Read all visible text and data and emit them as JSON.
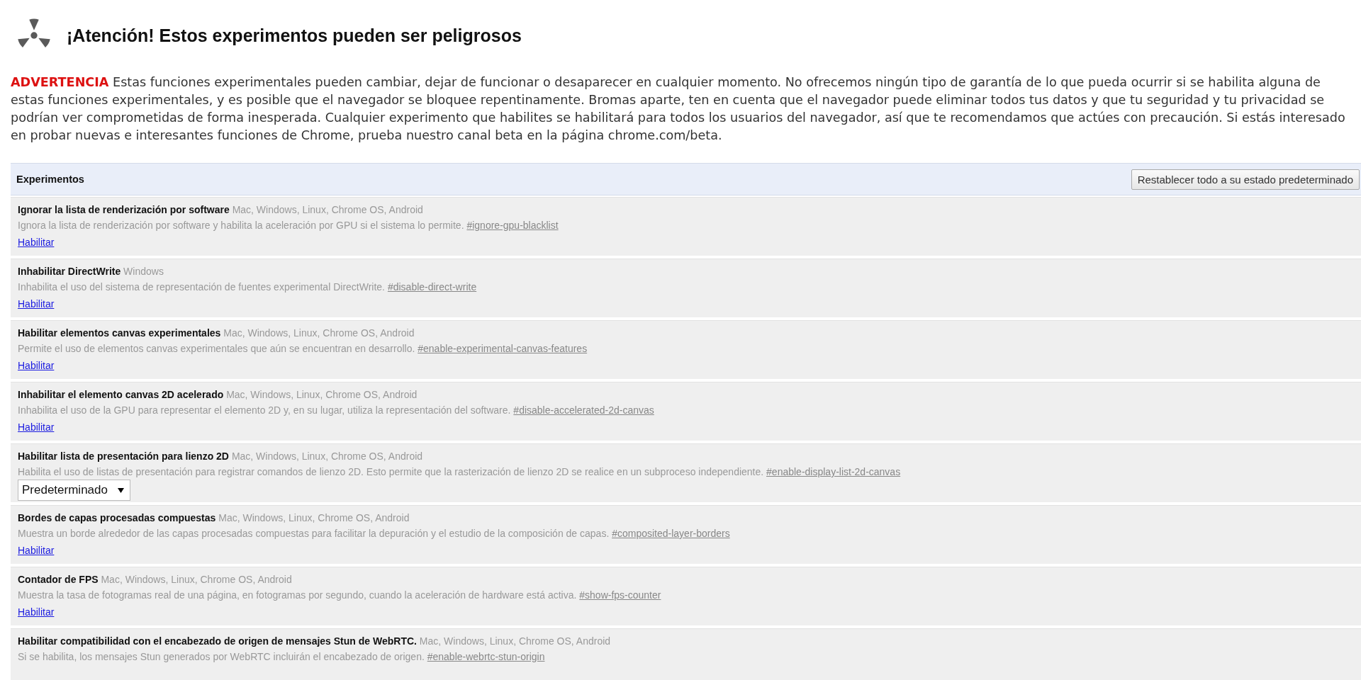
{
  "header": {
    "title": "¡Atención! Estos experimentos pueden ser peligrosos"
  },
  "warning": {
    "label": "ADVERTENCIA",
    "text": "Estas funciones experimentales pueden cambiar, dejar de funcionar o desaparecer en cualquier momento. No ofrecemos ningún tipo de garantía de lo que pueda ocurrir si se habilita alguna de estas funciones experimentales, y es posible que el navegador se bloquee repentinamente. Bromas aparte, ten en cuenta que el navegador puede eliminar todos tus datos y que tu seguridad y tu privacidad se podrían ver comprometidas de forma inesperada. Cualquier experimento que habilites se habilitará para todos los usuarios del navegador, así que te recomendamos que actúes con precaución. Si estás interesado en probar nuevas e interesantes funciones de Chrome, prueba nuestro canal beta en la página chrome.com/beta."
  },
  "experiments": {
    "heading": "Experimentos",
    "reset_button": "Restablecer todo a su estado predeterminado",
    "items": [
      {
        "name": "Ignorar la lista de renderización por software",
        "platforms": "Mac, Windows, Linux, Chrome OS, Android",
        "description": "Ignora la lista de renderización por software y habilita la aceleración por GPU si el sistema lo permite.",
        "flag": "#ignore-gpu-blacklist",
        "kind": "link",
        "control": "Habilitar"
      },
      {
        "name": "Inhabilitar DirectWrite",
        "platforms": "Windows",
        "description": "Inhabilita el uso del sistema de representación de fuentes experimental DirectWrite.",
        "flag": "#disable-direct-write",
        "kind": "link",
        "control": "Habilitar"
      },
      {
        "name": "Habilitar elementos canvas experimentales",
        "platforms": "Mac, Windows, Linux, Chrome OS, Android",
        "description": "Permite el uso de elementos canvas experimentales que aún se encuentran en desarrollo.",
        "flag": "#enable-experimental-canvas-features",
        "kind": "link",
        "control": "Habilitar"
      },
      {
        "name": "Inhabilitar el elemento canvas 2D acelerado",
        "platforms": "Mac, Windows, Linux, Chrome OS, Android",
        "description": "Inhabilita el uso de la GPU para representar el elemento 2D y, en su lugar, utiliza la representación del software.",
        "flag": "#disable-accelerated-2d-canvas",
        "kind": "link",
        "control": "Habilitar"
      },
      {
        "name": "Habilitar lista de presentación para lienzo 2D",
        "platforms": "Mac, Windows, Linux, Chrome OS, Android",
        "description": "Habilita el uso de listas de presentación para registrar comandos de lienzo 2D. Esto permite que la rasterización de lienzo 2D se realice en un subproceso independiente.",
        "flag": "#enable-display-list-2d-canvas",
        "kind": "select",
        "control": "Predeterminado"
      },
      {
        "name": "Bordes de capas procesadas compuestas",
        "platforms": "Mac, Windows, Linux, Chrome OS, Android",
        "description": "Muestra un borde alrededor de las capas procesadas compuestas para facilitar la depuración y el estudio de la composición de capas.",
        "flag": "#composited-layer-borders",
        "kind": "link",
        "control": "Habilitar"
      },
      {
        "name": "Contador de FPS",
        "platforms": "Mac, Windows, Linux, Chrome OS, Android",
        "description": "Muestra la tasa de fotogramas real de una página, en fotogramas por segundo, cuando la aceleración de hardware está activa.",
        "flag": "#show-fps-counter",
        "kind": "link",
        "control": "Habilitar"
      },
      {
        "name": "Habilitar compatibilidad con el encabezado de origen de mensajes Stun de WebRTC.",
        "platforms": "Mac, Windows, Linux, Chrome OS, Android",
        "description": "Si se habilita, los mensajes Stun generados por WebRTC incluirán el encabezado de origen.",
        "flag": "#enable-webrtc-stun-origin",
        "kind": "none"
      }
    ]
  }
}
